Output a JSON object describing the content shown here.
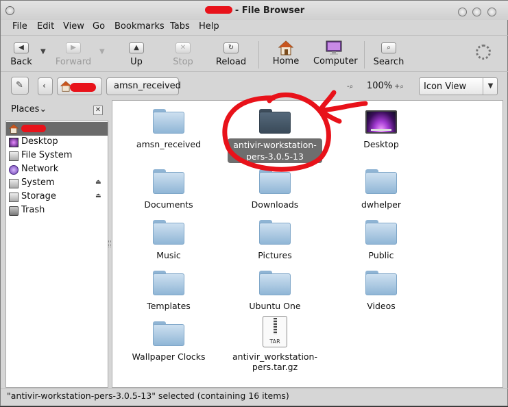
{
  "window": {
    "title_suffix": "- File Browser"
  },
  "menubar": [
    "File",
    "Edit",
    "View",
    "Go",
    "Bookmarks",
    "Tabs",
    "Help"
  ],
  "toolbar": {
    "back": "Back",
    "forward": "Forward",
    "up": "Up",
    "stop": "Stop",
    "reload": "Reload",
    "home": "Home",
    "computer": "Computer",
    "search": "Search"
  },
  "location": {
    "crumb_current": "amsn_received",
    "zoom": "100%",
    "view_mode": "Icon View"
  },
  "sidebar": {
    "title": "Places",
    "items": [
      {
        "label": "",
        "icon": "home-icon",
        "selected": true
      },
      {
        "label": "Desktop",
        "icon": "desktop-icon"
      },
      {
        "label": "File System",
        "icon": "drive-icon"
      },
      {
        "label": "Network",
        "icon": "network-icon"
      },
      {
        "label": "System",
        "icon": "drive-icon",
        "eject": true
      },
      {
        "label": "Storage",
        "icon": "drive-icon",
        "eject": true
      },
      {
        "label": "Trash",
        "icon": "trash-icon"
      }
    ]
  },
  "files": [
    {
      "name": "amsn_received",
      "type": "folder"
    },
    {
      "name_lines": [
        "antivir-workstation-",
        "pers-3.0.5-13"
      ],
      "name": "antivir-workstation-pers-3.0.5-13",
      "type": "folder",
      "selected": true
    },
    {
      "name": "Desktop",
      "type": "desktop"
    },
    {
      "name": "Documents",
      "type": "folder"
    },
    {
      "name": "Downloads",
      "type": "folder"
    },
    {
      "name": "dwhelper",
      "type": "folder"
    },
    {
      "name": "Music",
      "type": "folder"
    },
    {
      "name": "Pictures",
      "type": "folder"
    },
    {
      "name": "Public",
      "type": "folder"
    },
    {
      "name": "Templates",
      "type": "folder"
    },
    {
      "name": "Ubuntu One",
      "type": "folder"
    },
    {
      "name": "Videos",
      "type": "folder"
    },
    {
      "name": "Wallpaper Clocks",
      "type": "folder"
    },
    {
      "name_lines": [
        "antivir_workstation-",
        "pers.tar.gz"
      ],
      "name": "antivir_workstation-pers.tar.gz",
      "type": "archive",
      "badge": "TAR"
    }
  ],
  "status": "\"antivir-workstation-pers-3.0.5-13\" selected (containing 16 items)",
  "colors": {
    "annotation": "#e8121a",
    "selection": "#6e6e6e"
  }
}
